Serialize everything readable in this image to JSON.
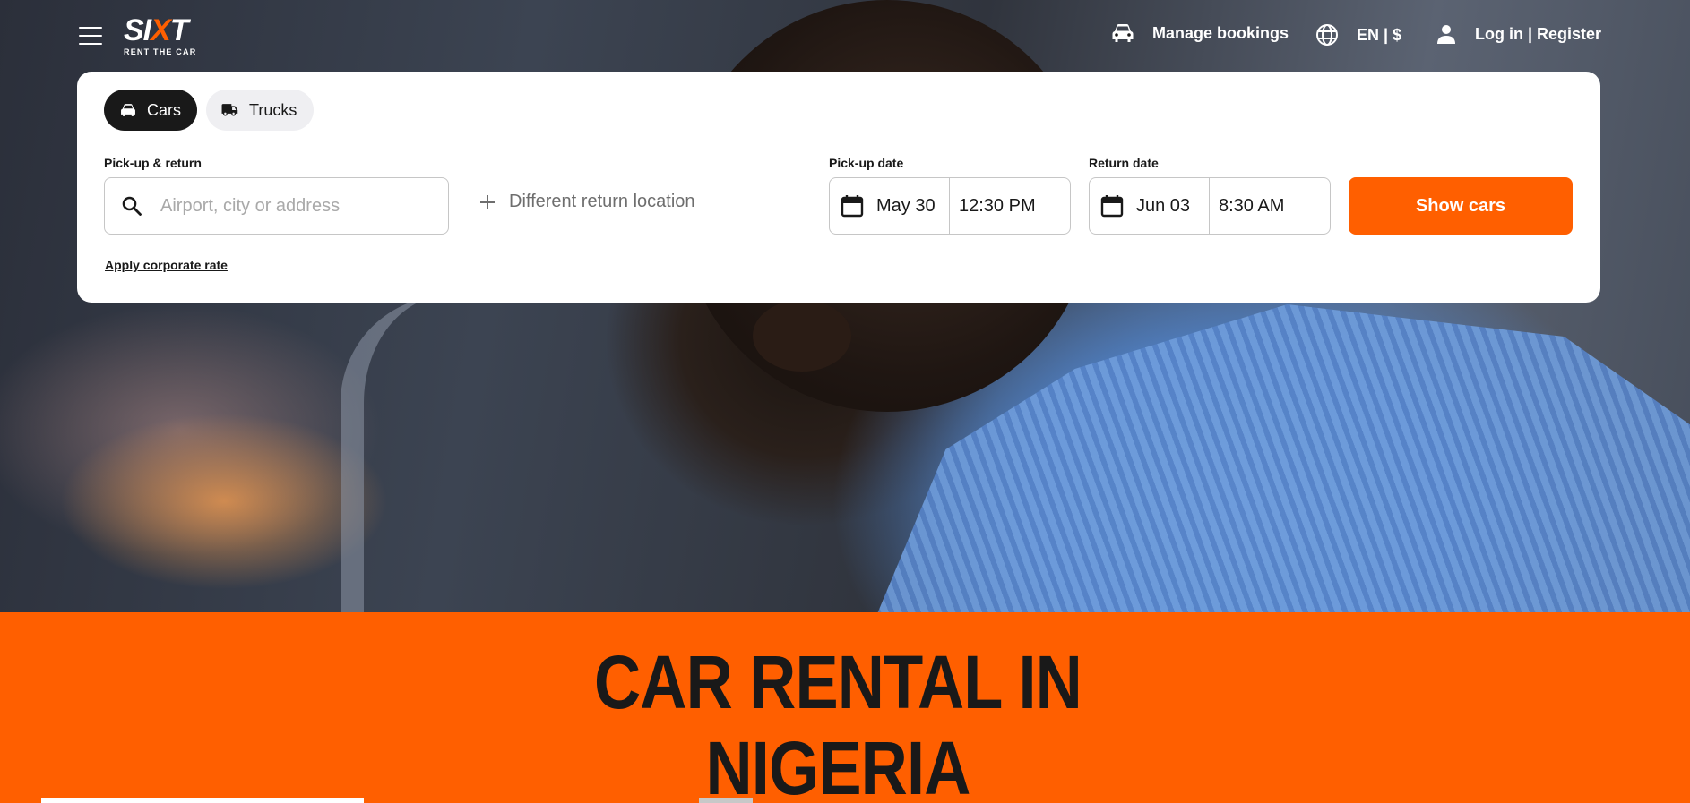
{
  "header": {
    "menu_icon": "hamburger-menu-icon",
    "logo": {
      "brand": "SIXT",
      "tagline": "RENT THE CAR",
      "accent_color": "#ff5f00"
    },
    "manage_bookings": "Manage bookings",
    "language_currency": "EN | $",
    "login_register": "Log in | Register"
  },
  "booking": {
    "tabs": [
      {
        "label": "Cars",
        "icon": "car-icon",
        "selected": true
      },
      {
        "label": "Trucks",
        "icon": "truck-icon",
        "selected": false
      }
    ],
    "pickup_return_label": "Pick-up & return",
    "location_placeholder": "Airport, city or address",
    "location_value": "",
    "different_return": "Different return location",
    "pickup_date_label": "Pick-up date",
    "pickup_date": "May 30",
    "pickup_time": "12:30 PM",
    "return_date_label": "Return date",
    "return_date": "Jun 03",
    "return_time": "8:30 AM",
    "submit_label": "Show cars",
    "corporate_rate": "Apply corporate rate"
  },
  "banner": {
    "title_line1": "CAR RENTAL IN",
    "title_line2": "NIGERIA",
    "background_color": "#ff5f00"
  }
}
